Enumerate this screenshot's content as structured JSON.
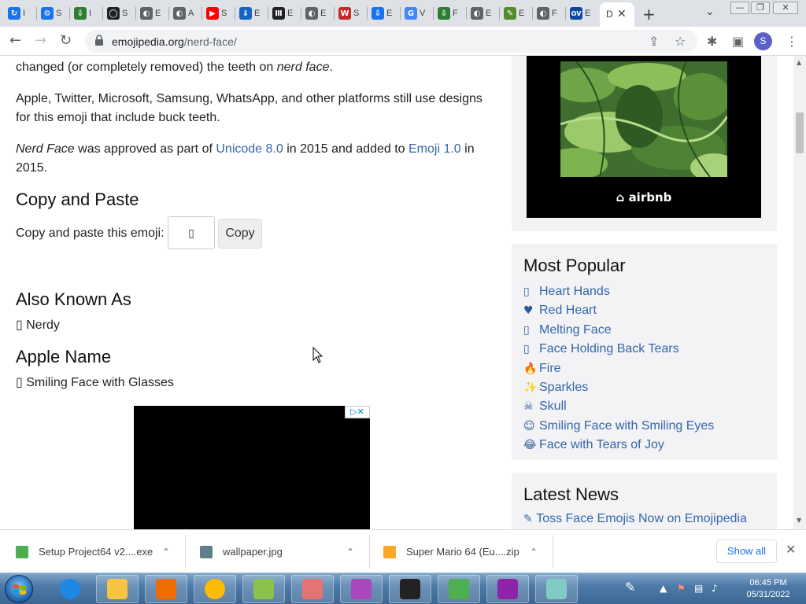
{
  "browser": {
    "tabs": [
      {
        "label": "I",
        "color": "#1a73e8",
        "glyph": "↻"
      },
      {
        "label": "S",
        "color": "#1a73e8",
        "glyph": "⚙"
      },
      {
        "label": "I",
        "color": "#2e7d32",
        "glyph": "⇩"
      },
      {
        "label": "S",
        "color": "#202124",
        "glyph": "◯"
      },
      {
        "label": "E",
        "color": "#5f6368",
        "glyph": "◐"
      },
      {
        "label": "A",
        "color": "#5f6368",
        "glyph": "◐"
      },
      {
        "label": "S",
        "color": "#ff0000",
        "glyph": "▶"
      },
      {
        "label": "E",
        "color": "#1565c0",
        "glyph": "⇓"
      },
      {
        "label": "E",
        "color": "#202124",
        "glyph": "Ⅲ"
      },
      {
        "label": "E",
        "color": "#5f6368",
        "glyph": "◐"
      },
      {
        "label": "S",
        "color": "#c62828",
        "glyph": "W"
      },
      {
        "label": "E",
        "color": "#1a73e8",
        "glyph": "⇩"
      },
      {
        "label": "V",
        "color": "#4285f4",
        "glyph": "G"
      },
      {
        "label": "F",
        "color": "#2e7d32",
        "glyph": "⇩"
      },
      {
        "label": "E",
        "color": "#5f6368",
        "glyph": "◐"
      },
      {
        "label": "E",
        "color": "#558b2f",
        "glyph": "✎"
      },
      {
        "label": "F",
        "color": "#5f6368",
        "glyph": "◐"
      },
      {
        "label": "E",
        "color": "#0d47a1",
        "glyph": "OV"
      }
    ],
    "active_tab": {
      "label": "D",
      "close": "✕"
    },
    "new_tab": "+",
    "tab_list": "⌄",
    "window_controls": {
      "minimize": "—",
      "maximize": "❐",
      "close": "✕"
    },
    "nav": {
      "back": "←",
      "forward": "→",
      "reload": "↻"
    },
    "url_host": "emojipedia.org",
    "url_path": "/nerd-face/",
    "toolbar_icons": {
      "share": "⇪",
      "bookmark": "☆",
      "extensions": "✱",
      "sidebar": "▣",
      "menu": "⋮"
    },
    "profile_initial": "S"
  },
  "article": {
    "p1_text": "changed (or completely removed) the teeth on ",
    "p1_em": "nerd face",
    "p1_end": ".",
    "p2": "Apple, Twitter, Microsoft, Samsung, WhatsApp, and other platforms still use designs for this emoji that include buck teeth.",
    "p3_em": "Nerd Face",
    "p3_a": " was approved as part of ",
    "p3_link1": "Unicode 8.0",
    "p3_b": " in 2015 and added to ",
    "p3_link2": "Emoji 1.0",
    "p3_c": " in 2015.",
    "copy_heading": "Copy and Paste",
    "copy_label": "Copy and paste this emoji:",
    "copy_emoji": "▯",
    "copy_button": "Copy",
    "aka_heading": "Also Known As",
    "aka_item": "▯ Nerdy",
    "apple_heading": "Apple Name",
    "apple_item": "▯ Smiling Face with Glasses",
    "adchoices": "▷✕"
  },
  "sidebar": {
    "ad_brand": "airbnb",
    "popular_heading": "Most Popular",
    "popular": [
      {
        "emoji": "▯",
        "label": "Heart Hands",
        "color": "#3366aa"
      },
      {
        "emoji": "♥",
        "label": "Red Heart",
        "color": "#2b5797"
      },
      {
        "emoji": "▯",
        "label": "Melting Face",
        "color": "#3366aa"
      },
      {
        "emoji": "▯",
        "label": "Face Holding Back Tears",
        "color": "#3366aa"
      },
      {
        "emoji": "🔥",
        "label": "Fire",
        "color": "#2b5797"
      },
      {
        "emoji": "✨",
        "label": "Sparkles",
        "color": "#2b5797"
      },
      {
        "emoji": "☠",
        "label": "Skull",
        "color": "#2b5797"
      },
      {
        "emoji": "☺",
        "label": "Smiling Face with Smiling Eyes",
        "color": "#2b5797"
      },
      {
        "emoji": "😂",
        "label": "Face with Tears of Joy",
        "color": "#2b5797"
      }
    ],
    "news_heading": "Latest News",
    "news_item": "Toss Face Emojis Now on Emojipedia"
  },
  "downloads": {
    "items": [
      {
        "name": "Setup Project64 v2....exe",
        "icon_color": "#4caf50"
      },
      {
        "name": "wallpaper.jpg",
        "icon_color": "#607d8b"
      },
      {
        "name": "Super Mario 64 (Eu....zip",
        "icon_color": "#f9a825"
      }
    ],
    "chevron": "⌃",
    "show_all": "Show all",
    "close": "✕"
  },
  "taskbar": {
    "apps": [
      {
        "name": "internet-explorer",
        "color": "#1e88e5"
      },
      {
        "name": "file-explorer",
        "color": "#f6c443"
      },
      {
        "name": "media-player",
        "color": "#ef6c00"
      },
      {
        "name": "chrome",
        "color": "#fbbc05"
      },
      {
        "name": "paint",
        "color": "#8bc34a"
      },
      {
        "name": "crayon-app",
        "color": "#e57373"
      },
      {
        "name": "paint-brush-app",
        "color": "#ab47bc"
      },
      {
        "name": "7zip",
        "color": "#222222"
      },
      {
        "name": "project64",
        "color": "#4caf50"
      },
      {
        "name": "winrar",
        "color": "#8e24aa"
      },
      {
        "name": "notepad-app",
        "color": "#80cbc4"
      }
    ],
    "time": "06:45 PM",
    "date": "05/31/2022"
  }
}
